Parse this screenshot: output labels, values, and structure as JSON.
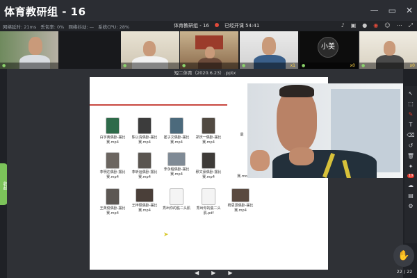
{
  "window": {
    "title": "体育教研组 - 16",
    "minimize_glyph": "—",
    "maximize_glyph": "▭",
    "close_glyph": "✕"
  },
  "infobar": {
    "latency": "网络延时: 21ms",
    "loss": "丢包率: 0%",
    "jitter": "网络抖动: —",
    "cpu": "系统CPU: 28%",
    "meeting_name": "体育教研组 - 16",
    "recording_status": "已经开课 54:41",
    "right_icons": [
      "bell-icon",
      "camera-icon",
      "mic-icon",
      "record-icon",
      "user-icon",
      "more-icon",
      "expand-icon"
    ]
  },
  "participants": [
    {
      "name": "",
      "count": ""
    },
    {
      "name": "",
      "count": ""
    },
    {
      "name": "",
      "count": ""
    },
    {
      "name": "",
      "count": "x1"
    },
    {
      "name": "小美",
      "count": "x0"
    },
    {
      "name": "",
      "count": "x0"
    }
  ],
  "document": {
    "title": "短二体育（2020.6.23）.pptx",
    "page_indicator": "22 / 22",
    "files": [
      {
        "label": "白宇奥偶卧-摆比赛.mp4"
      },
      {
        "label": "陈以清偶卧-摆比赛.mp4"
      },
      {
        "label": "崔子文偶卧-摆比赛.mp4"
      },
      {
        "label": "郑庆一偶卧-摆比赛.mp4"
      },
      {
        "label": "李明达偶卧-摆比赛.mp4"
      },
      {
        "label": "李昕运偶卧-摆比赛.mp4"
      },
      {
        "label": "李永程偶卧-摆比赛.mp4"
      },
      {
        "label": "穆文豪偶卧-摆比赛.mp4"
      },
      {
        "label": "王英俊偶卧-摆比赛.mp4"
      },
      {
        "label": "王梓硕偶卧-摆比赛.mp4"
      },
      {
        "label": "秀出你的肱二头肌"
      },
      {
        "label": "秀出你的肱二头肌.pdf"
      },
      {
        "label": "杨思源偶卧-摆比赛.mp4"
      }
    ],
    "partial_labels": [
      "最",
      "赛.mov",
      "赛.mp4",
      "赛.mp4"
    ]
  },
  "toolbar_right": {
    "items": [
      "cursor-icon",
      "select-icon",
      "pen-icon",
      "shape-icon",
      "eraser-icon",
      "undo-icon",
      "delete-icon",
      "laser-icon",
      "mic-icon"
    ],
    "badge": "10"
  },
  "side_handle_label": "收起"
}
